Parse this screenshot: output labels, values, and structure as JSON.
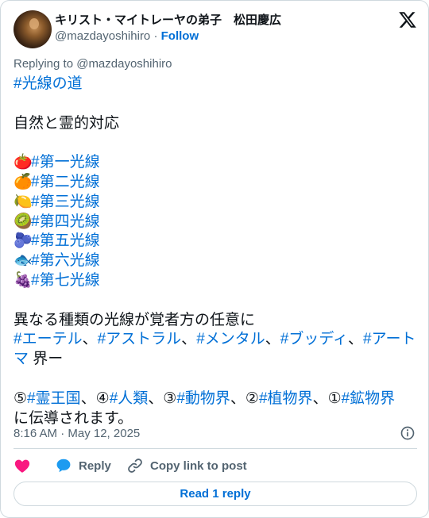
{
  "author": {
    "display_name": "キリスト・マイトレーヤの弟子　松田慶広",
    "handle": "@mazdayoshihiro",
    "separator": "·",
    "follow_label": "Follow"
  },
  "reply_to": "Replying to @mazdayoshihiro",
  "tweet": {
    "hashtag_title": "#光線の道",
    "line_nature": "自然と霊的対応",
    "rays": [
      {
        "emoji": "🍅",
        "tag": "#第一光線"
      },
      {
        "emoji": "🍊",
        "tag": "#第二光線"
      },
      {
        "emoji": "🍋",
        "tag": "#第三光線"
      },
      {
        "emoji": "🥝",
        "tag": "#第四光線"
      },
      {
        "emoji": "🫐",
        "tag": "#第五光線"
      },
      {
        "emoji": "🐟",
        "tag": "#第六光線"
      },
      {
        "emoji": "🍇",
        "tag": "#第七光線"
      }
    ],
    "line_masters": "異なる種類の光線が覚者方の任意に",
    "planes": {
      "etheric": "#エーテル",
      "astral": "#アストラル",
      "mental": "#メンタル",
      "buddhic": "#ブッディ",
      "atma": "#アートマ",
      "sep": "、",
      "suffix": " 界ー"
    },
    "kingdoms": {
      "n5": "⑤",
      "spirit": "#霊王国",
      "n4": "④",
      "human": "#人類",
      "n3": "③",
      "animal": "#動物界",
      "n2": "②",
      "plant": "#植物界",
      "n1": "①",
      "mineral": "#鉱物界",
      "sep": "、",
      "ending": "に伝導されます。"
    }
  },
  "timestamp": "8:16 AM · May 12, 2025",
  "actions": {
    "reply_label": "Reply",
    "copy_label": "Copy link to post",
    "read_reply_label": "Read 1 reply"
  },
  "colors": {
    "link": "#006fd6",
    "heart": "#f91880",
    "reply_bubble": "#1d9bf0",
    "muted": "#536471"
  }
}
